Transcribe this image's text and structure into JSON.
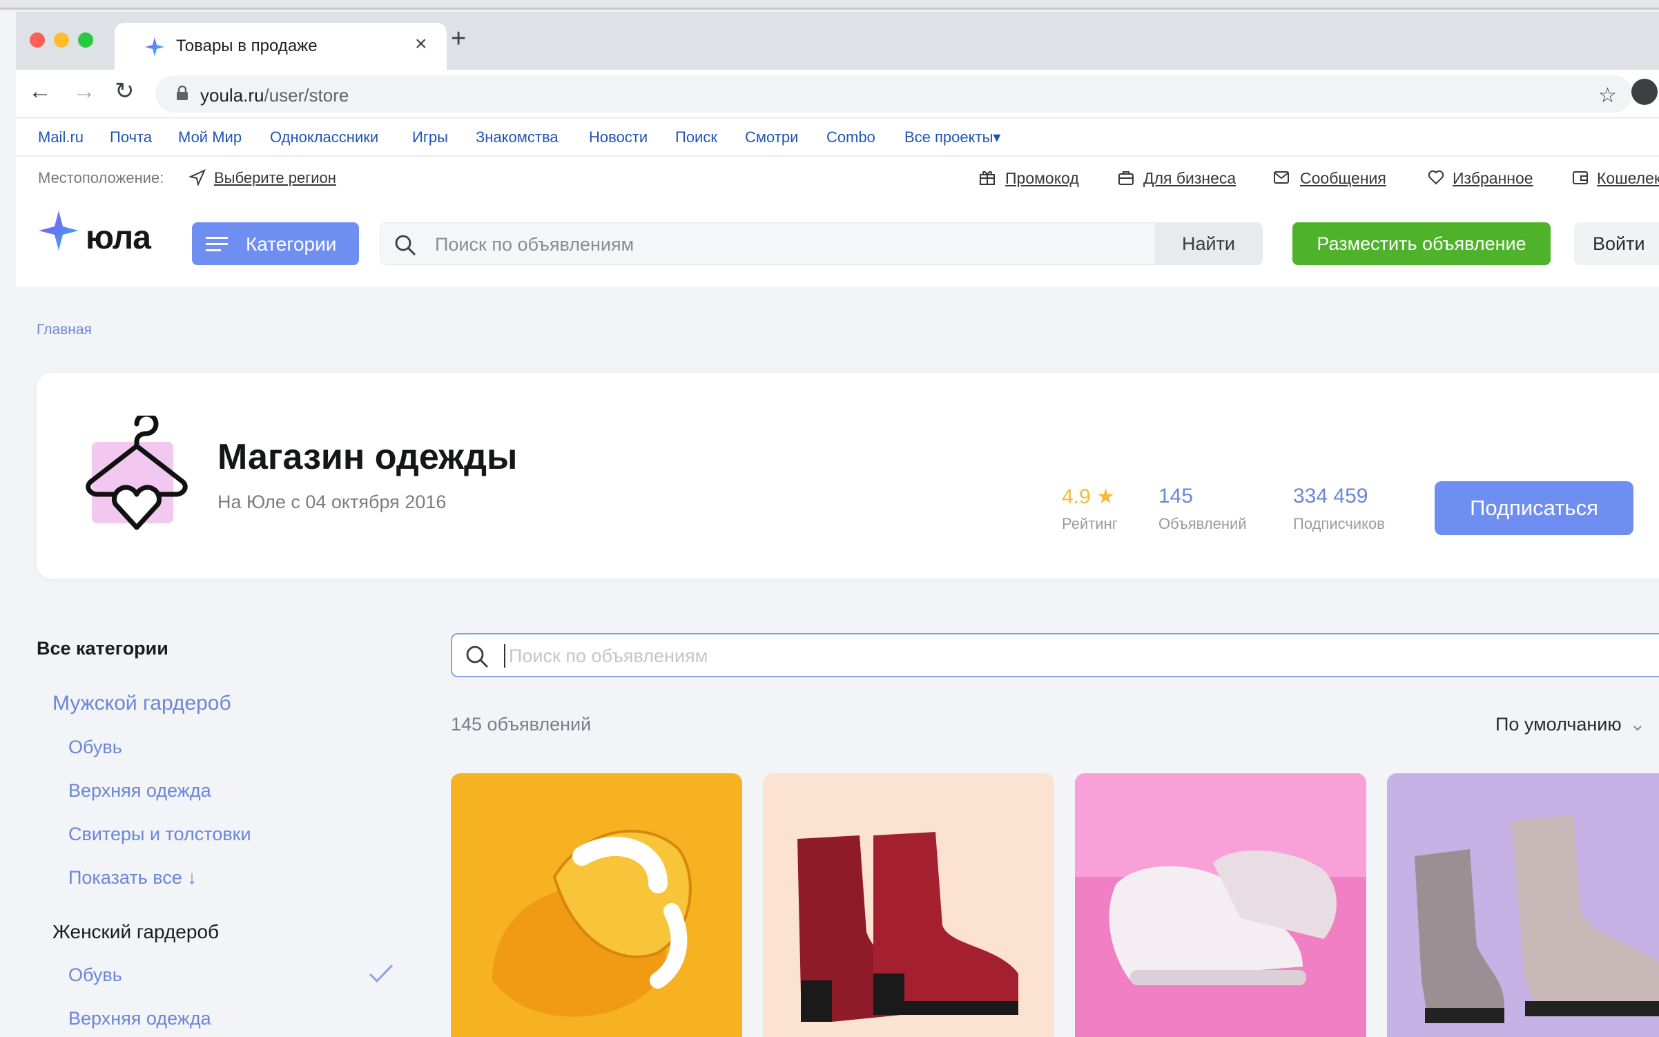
{
  "browser": {
    "tab_title": "Товары в продаже",
    "tab_close": "×",
    "new_tab": "+",
    "url_host": "youla.ru",
    "url_path": "/user/store",
    "star": "☆"
  },
  "bookmarks": [
    "Mail.ru",
    "Почта",
    "Мой Мир",
    "Одноклассники",
    "Игры",
    "Знакомства",
    "Новости",
    "Поиск",
    "Смотри",
    "Combo",
    "Все проекты▾"
  ],
  "topline": {
    "location_label": "Местоположение:",
    "location_link": "Выберите регион",
    "links": [
      "Промокод",
      "Для бизнеса",
      "Сообщения",
      "Избранное",
      "Кошелек"
    ]
  },
  "header": {
    "logo": "юла",
    "categories_button": "Категории",
    "search_placeholder": "Поиск по объявлениям",
    "find_button": "Найти",
    "post_button": "Разместить объявление",
    "login_button": "Войти"
  },
  "breadcrumb": "Главная",
  "store": {
    "title": "Магазин одежды",
    "subtitle": "На Юле с 04 октября 2016",
    "rating_value": "4.9",
    "rating_star": "★",
    "rating_label": "Рейтинг",
    "ads_value": "145",
    "ads_label": "Объявлений",
    "subs_value": "334 459",
    "subs_label": "Подписчиков",
    "subscribe_button": "Подписаться"
  },
  "sidebar": {
    "title": "Все категории",
    "men_group": "Мужской гардероб",
    "men_items": [
      "Обувь",
      "Верхняя одежда",
      "Свитеры и толстовки",
      "Показать все ↓"
    ],
    "women_group": "Женский гардероб",
    "women_items": [
      "Обувь",
      "Верхняя одежда"
    ]
  },
  "listing": {
    "search_placeholder": "Поиск по объявлениям",
    "count_text": "145 объявлений",
    "sort_label": "По умолчанию",
    "sort_chevron": "⌄"
  },
  "colors": {
    "accent_blue": "#6e8ef2",
    "green": "#4eb22a",
    "link_blue": "#6b86d8",
    "rating_gold": "#f5b93c"
  },
  "icons": [
    "back-icon",
    "forward-icon",
    "reload-icon",
    "lock-icon",
    "star-icon",
    "profile-icon",
    "location-icon",
    "gift-icon",
    "briefcase-icon",
    "mail-icon",
    "heart-icon",
    "wallet-icon",
    "menu-icon",
    "search-icon",
    "check-icon"
  ]
}
